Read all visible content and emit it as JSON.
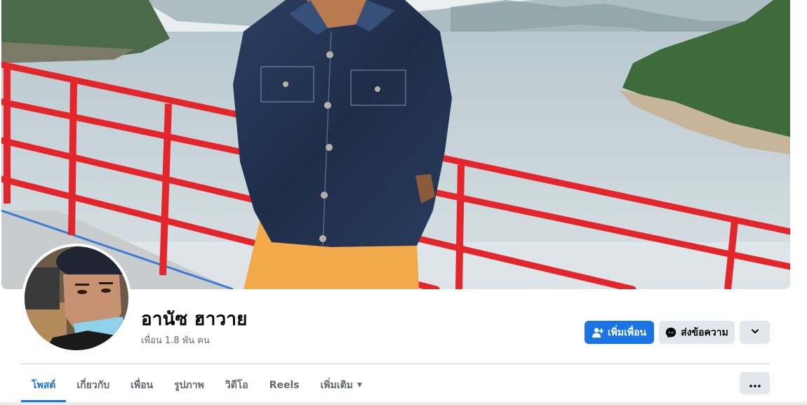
{
  "profile": {
    "name": "อานัซ ฮาวาย",
    "friends_count": "เพื่อน 1.8 พัน คน"
  },
  "actions": {
    "add_friend": "เพิ่มเพื่อน",
    "message": "ส่งข้อความ"
  },
  "tabs": [
    {
      "label": "โพสต์",
      "active": true
    },
    {
      "label": "เกี่ยวกับ"
    },
    {
      "label": "เพื่อน"
    },
    {
      "label": "รูปภาพ"
    },
    {
      "label": "วิดีโอ"
    },
    {
      "label": "Reels"
    },
    {
      "label": "เพิ่มเติม"
    }
  ],
  "icons": {
    "add_friend": "add-person-icon",
    "message": "messenger-icon",
    "more": "chevron-down-icon",
    "tab_more": "caret-down-icon",
    "options": "more-horizontal-icon"
  },
  "colors": {
    "accent": "#1b74e4",
    "button_gray": "#e4e6eb",
    "secondary_text": "#65676b"
  }
}
